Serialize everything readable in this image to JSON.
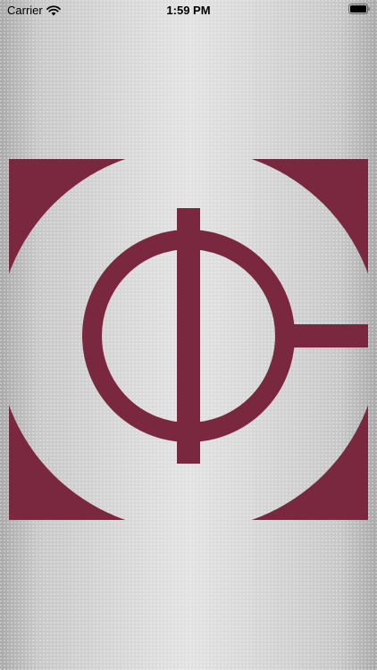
{
  "status_bar": {
    "carrier": "Carrier",
    "time": "1:59 PM",
    "wifi_icon": "wifi-icon",
    "battery_icon": "battery-icon"
  },
  "splash": {
    "logo_icon": "company-logo-icon",
    "brand_color": "#7a2840"
  }
}
